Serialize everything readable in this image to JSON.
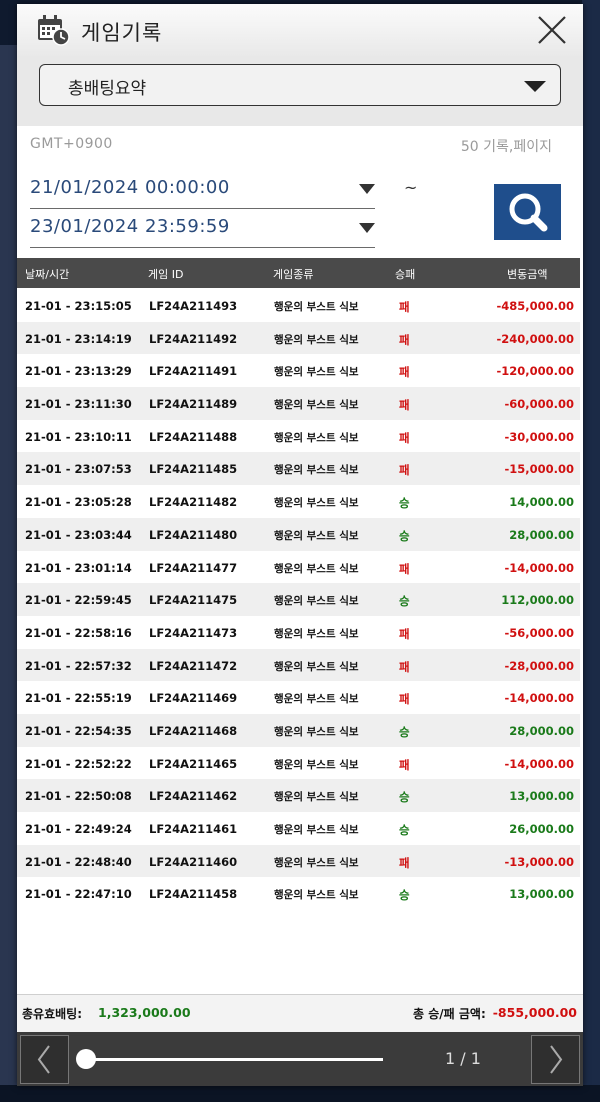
{
  "header": {
    "title": "게임기록"
  },
  "filter": {
    "selected": "총배팅요약"
  },
  "meta": {
    "timezone": "GMT+0900",
    "per_page": "50 기록,페이지"
  },
  "dates": {
    "from": "21/01/2024 00:00:00",
    "to": "23/01/2024 23:59:59",
    "separator": "~"
  },
  "table": {
    "columns": [
      "날짜/시간",
      "게임 ID",
      "게임종류",
      "승패",
      "변동금액"
    ],
    "rows": [
      {
        "time": "21-01 - 23:15:05",
        "id": "LF24A211493",
        "game": "행운의 부스트 식보",
        "result": "패",
        "amount": "-485,000.00"
      },
      {
        "time": "21-01 - 23:14:19",
        "id": "LF24A211492",
        "game": "행운의 부스트 식보",
        "result": "패",
        "amount": "-240,000.00"
      },
      {
        "time": "21-01 - 23:13:29",
        "id": "LF24A211491",
        "game": "행운의 부스트 식보",
        "result": "패",
        "amount": "-120,000.00"
      },
      {
        "time": "21-01 - 23:11:30",
        "id": "LF24A211489",
        "game": "행운의 부스트 식보",
        "result": "패",
        "amount": "-60,000.00"
      },
      {
        "time": "21-01 - 23:10:11",
        "id": "LF24A211488",
        "game": "행운의 부스트 식보",
        "result": "패",
        "amount": "-30,000.00"
      },
      {
        "time": "21-01 - 23:07:53",
        "id": "LF24A211485",
        "game": "행운의 부스트 식보",
        "result": "패",
        "amount": "-15,000.00"
      },
      {
        "time": "21-01 - 23:05:28",
        "id": "LF24A211482",
        "game": "행운의 부스트 식보",
        "result": "승",
        "amount": "14,000.00"
      },
      {
        "time": "21-01 - 23:03:44",
        "id": "LF24A211480",
        "game": "행운의 부스트 식보",
        "result": "승",
        "amount": "28,000.00"
      },
      {
        "time": "21-01 - 23:01:14",
        "id": "LF24A211477",
        "game": "행운의 부스트 식보",
        "result": "패",
        "amount": "-14,000.00"
      },
      {
        "time": "21-01 - 22:59:45",
        "id": "LF24A211475",
        "game": "행운의 부스트 식보",
        "result": "승",
        "amount": "112,000.00"
      },
      {
        "time": "21-01 - 22:58:16",
        "id": "LF24A211473",
        "game": "행운의 부스트 식보",
        "result": "패",
        "amount": "-56,000.00"
      },
      {
        "time": "21-01 - 22:57:32",
        "id": "LF24A211472",
        "game": "행운의 부스트 식보",
        "result": "패",
        "amount": "-28,000.00"
      },
      {
        "time": "21-01 - 22:55:19",
        "id": "LF24A211469",
        "game": "행운의 부스트 식보",
        "result": "패",
        "amount": "-14,000.00"
      },
      {
        "time": "21-01 - 22:54:35",
        "id": "LF24A211468",
        "game": "행운의 부스트 식보",
        "result": "승",
        "amount": "28,000.00"
      },
      {
        "time": "21-01 - 22:52:22",
        "id": "LF24A211465",
        "game": "행운의 부스트 식보",
        "result": "패",
        "amount": "-14,000.00"
      },
      {
        "time": "21-01 - 22:50:08",
        "id": "LF24A211462",
        "game": "행운의 부스트 식보",
        "result": "승",
        "amount": "13,000.00"
      },
      {
        "time": "21-01 - 22:49:24",
        "id": "LF24A211461",
        "game": "행운의 부스트 식보",
        "result": "승",
        "amount": "26,000.00"
      },
      {
        "time": "21-01 - 22:48:40",
        "id": "LF24A211460",
        "game": "행운의 부스트 식보",
        "result": "패",
        "amount": "-13,000.00"
      },
      {
        "time": "21-01 - 22:47:10",
        "id": "LF24A211458",
        "game": "행운의 부스트 식보",
        "result": "승",
        "amount": "13,000.00"
      }
    ]
  },
  "summary": {
    "valid_bet_label": "총유효배팅:",
    "valid_bet_value": "1,323,000.00",
    "winloss_label": "총 승/패 금액:",
    "winloss_value": "-855,000.00"
  },
  "pager": {
    "indicator": "1 / 1"
  },
  "colors": {
    "accent": "#1f4e8c",
    "win": "#1a7a1a",
    "lose": "#d01010",
    "header_bg": "#4a4a4a"
  },
  "icons": {
    "header": "calendar-clock-icon",
    "close": "close-icon",
    "search": "search-icon",
    "prev": "chevron-left-icon",
    "next": "chevron-right-icon"
  }
}
